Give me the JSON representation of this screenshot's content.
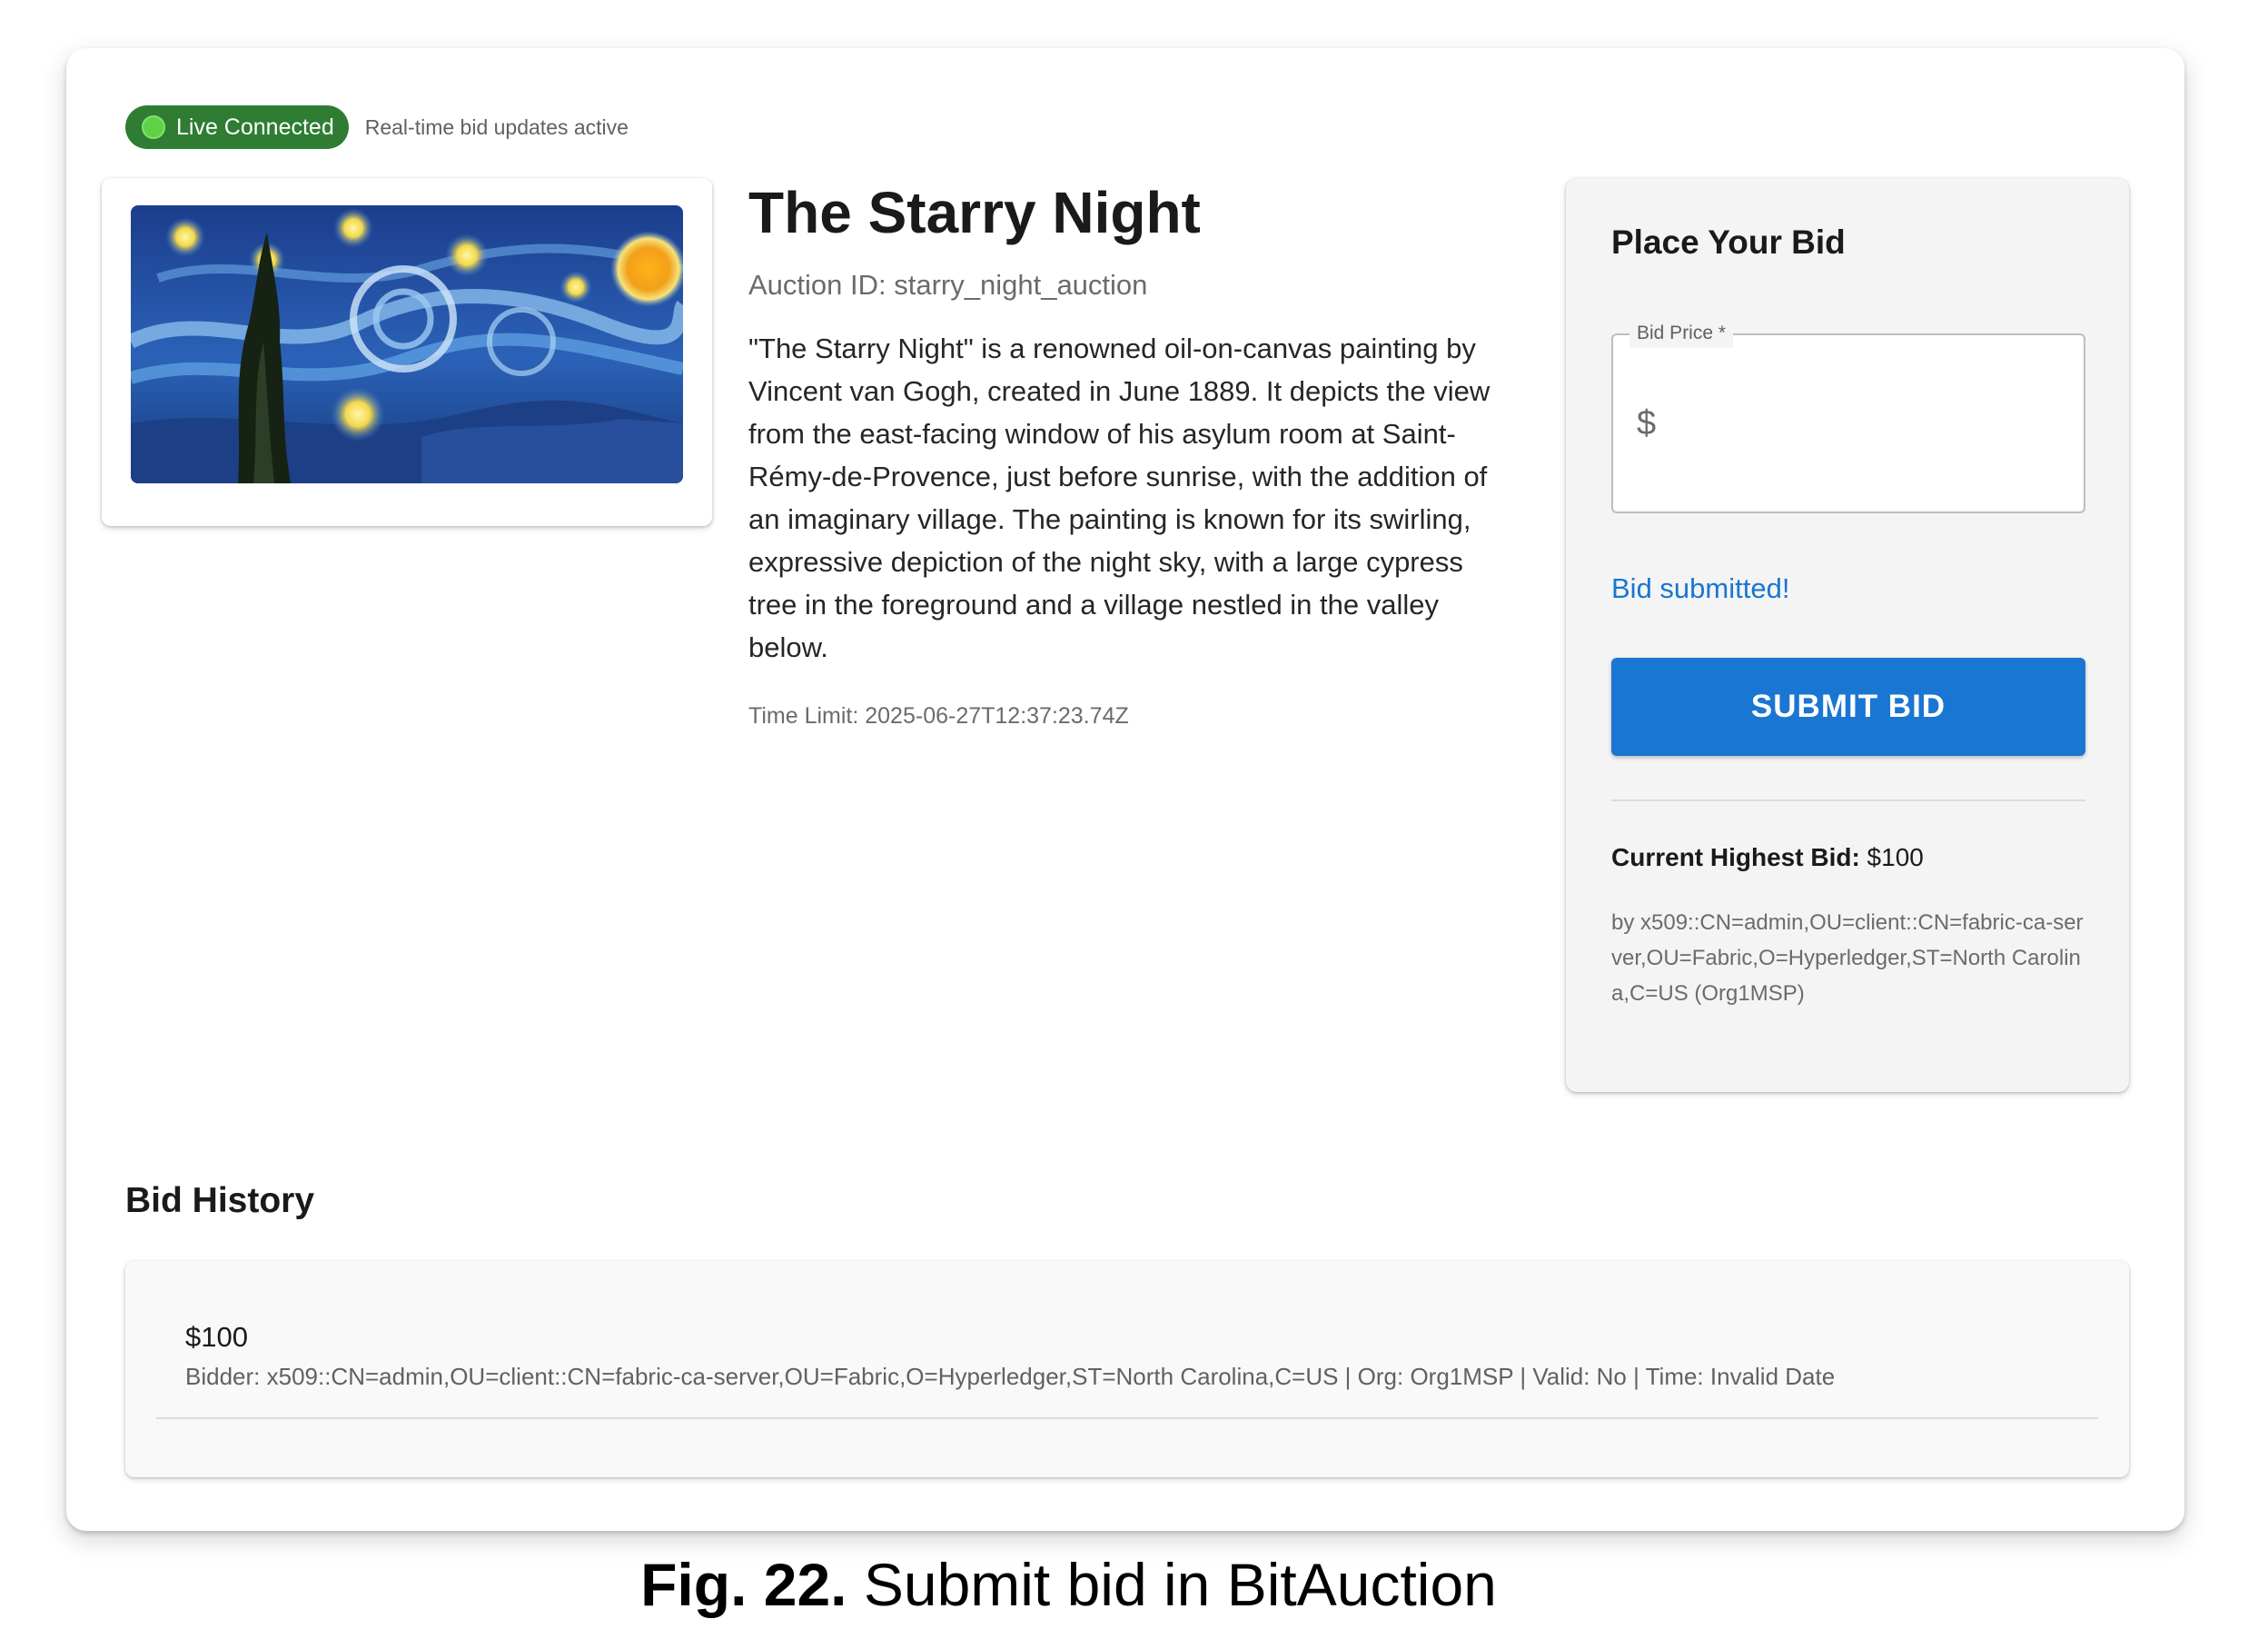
{
  "status": {
    "chip_label": "Live Connected",
    "note": "Real-time bid updates active",
    "color": "#2e7d32"
  },
  "auction": {
    "title": "The Starry Night",
    "id_text": "Auction ID: starry_night_auction",
    "description": "\"The Starry Night\" is a renowned oil-on-canvas painting by Vincent van Gogh, created in June 1889. It depicts the view from the east-facing window of his asylum room at Saint-Rémy-de-Provence, just before sunrise, with the addition of an imaginary village. The painting is known for its swirling, expressive depiction of the night sky, with a large cypress tree in the foreground and a village nestled in the valley below.",
    "time_limit": "Time Limit: 2025-06-27T12:37:23.74Z"
  },
  "bid_form": {
    "title": "Place Your Bid",
    "price_label": "Bid Price *",
    "price_prefix": "$",
    "price_value": "",
    "message": "Bid submitted!",
    "submit_label": "SUBMIT BID",
    "highest_label": "Current Highest Bid:",
    "highest_value": " $100",
    "highest_by": "by x509::CN=admin,OU=client::CN=fabric-ca-server,OU=Fabric,O=Hyperledger,ST=North Carolina,C=US (Org1MSP)",
    "accent_color": "#1976d2"
  },
  "history": {
    "title": "Bid History",
    "items": [
      {
        "amount": "$100",
        "detail": "Bidder: x509::CN=admin,OU=client::CN=fabric-ca-server,OU=Fabric,O=Hyperledger,ST=North Carolina,C=US | Org: Org1MSP | Valid: No | Time: Invalid Date"
      }
    ]
  },
  "caption": {
    "label": "Fig. 22.",
    "text": " Submit bid in BitAuction"
  }
}
